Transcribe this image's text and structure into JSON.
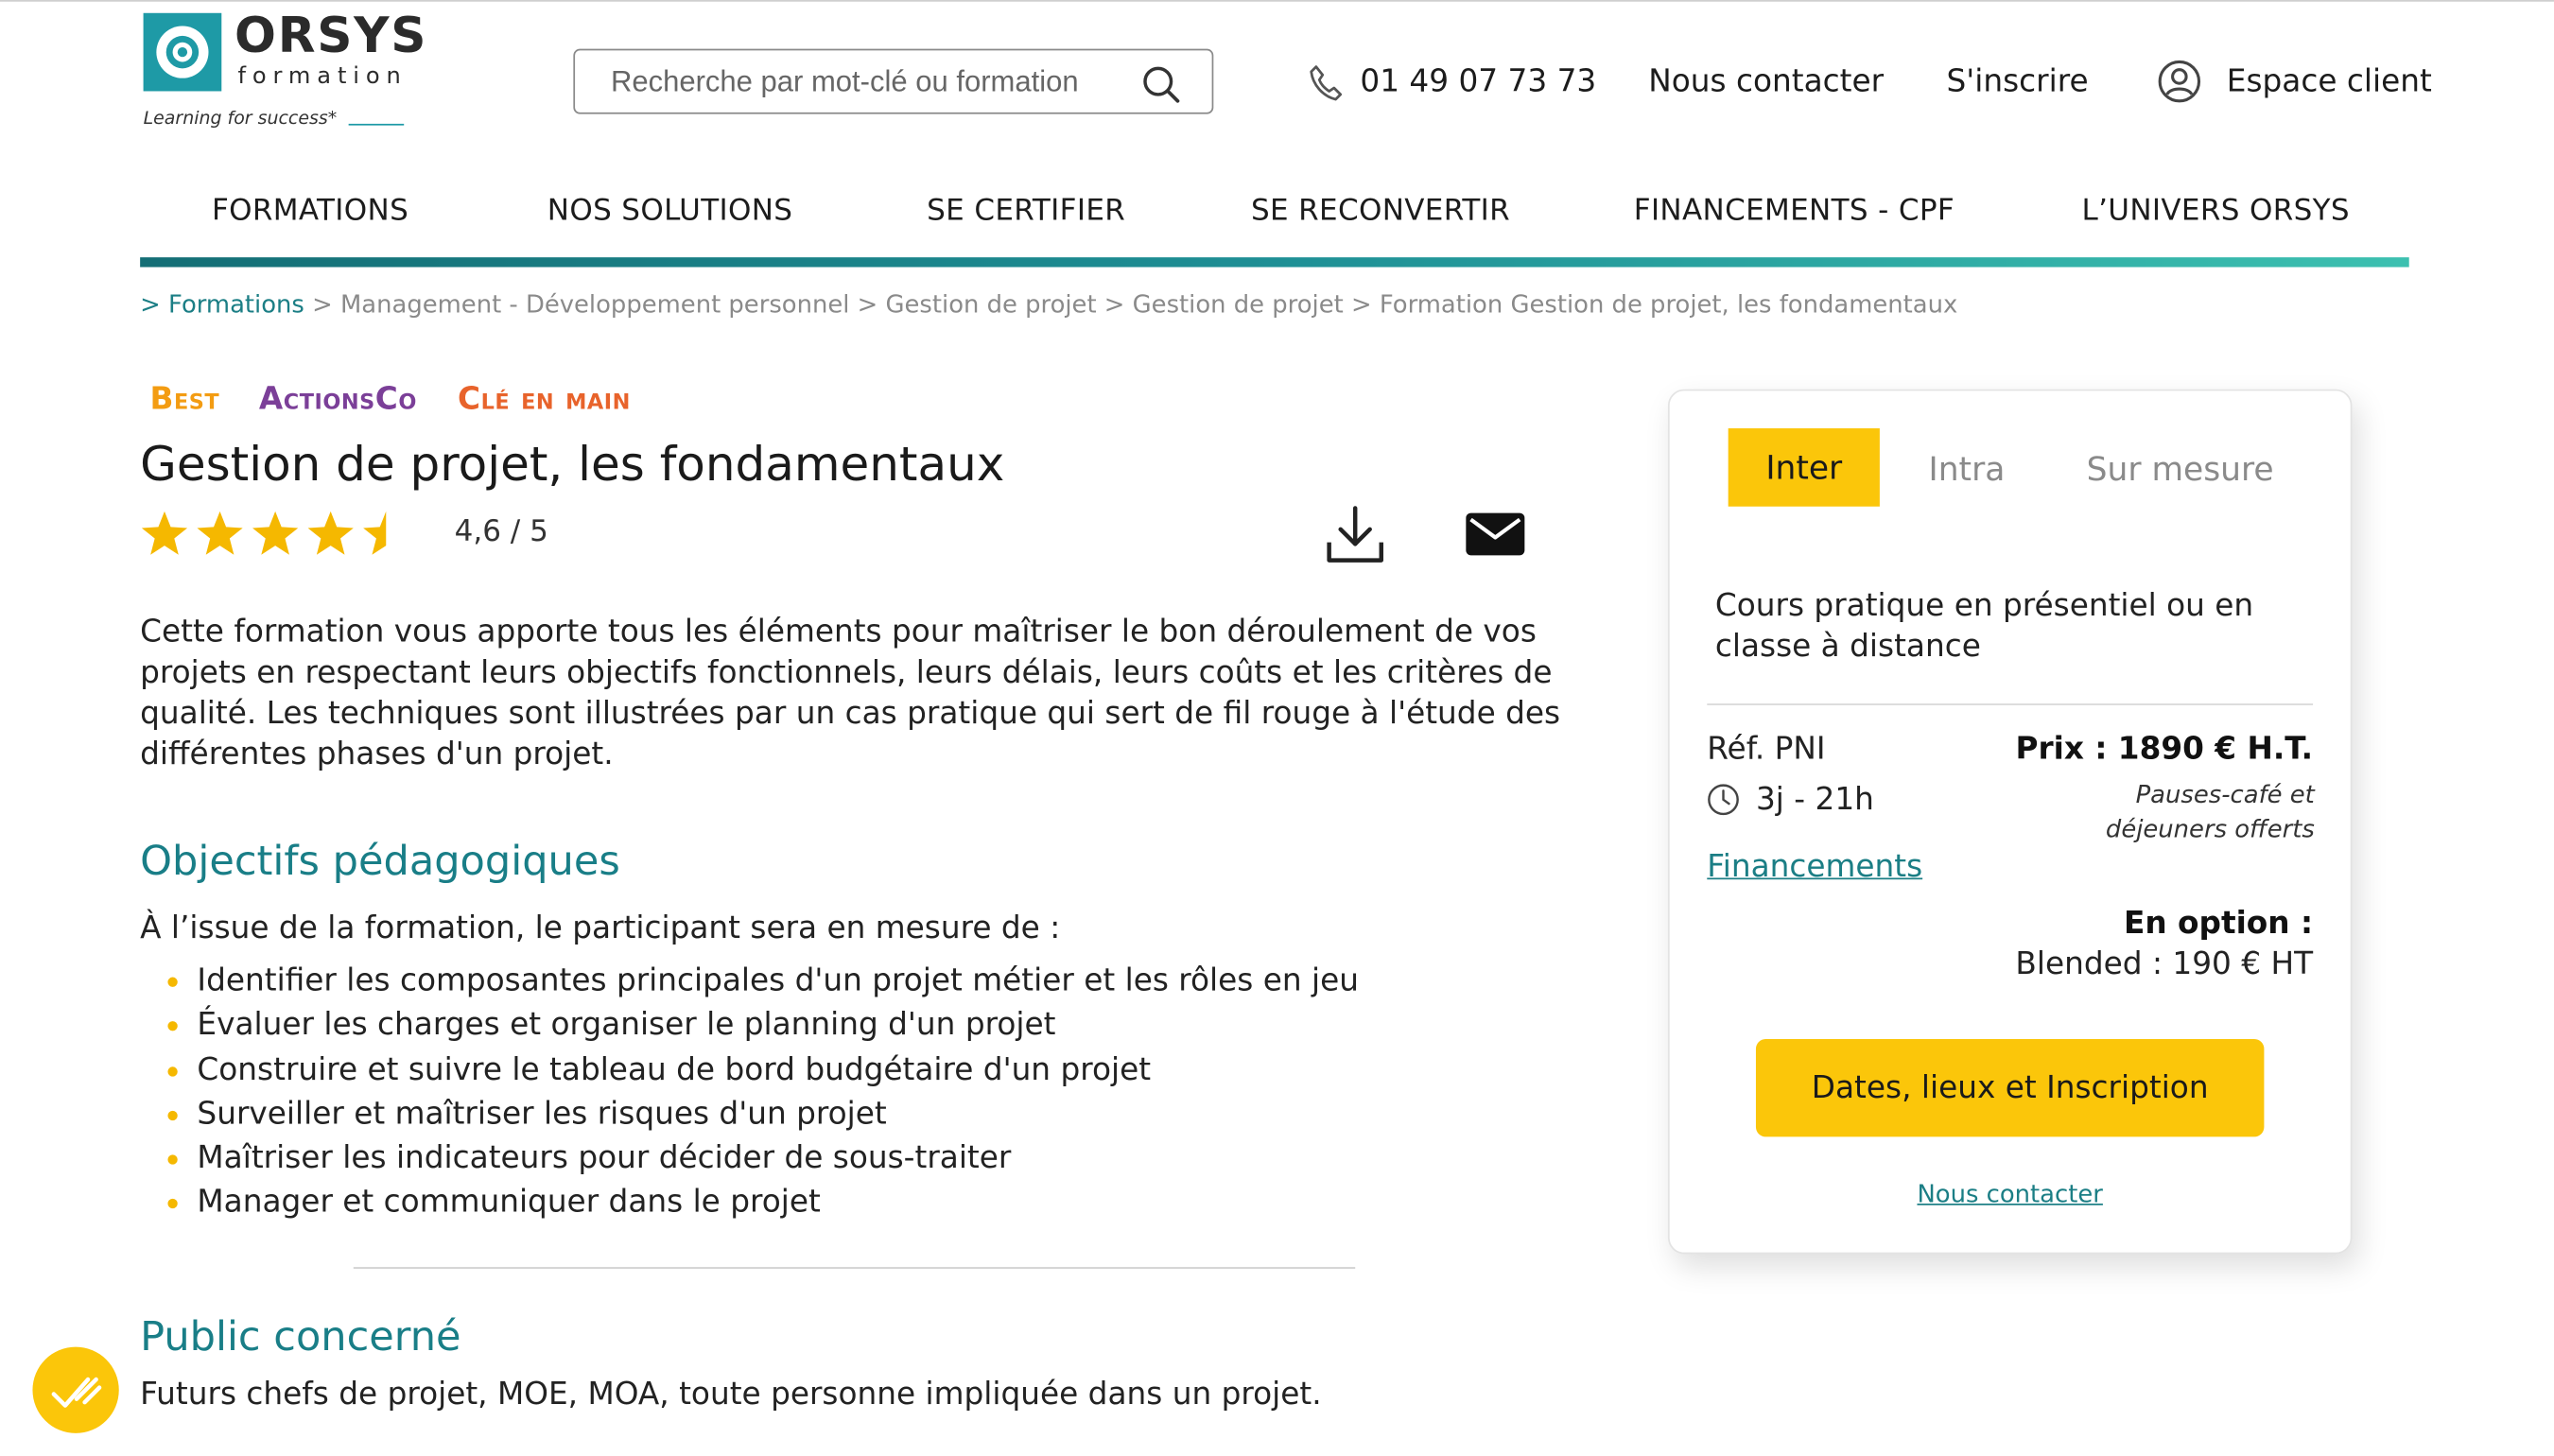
{
  "logo": {
    "name": "ORSYS",
    "sub": "formation",
    "tagline": "Learning for success*"
  },
  "search": {
    "placeholder": "Recherche par mot-clé ou formation"
  },
  "header": {
    "phone": "01 49 07 73 73",
    "contact": "Nous contacter",
    "register": "S'inscrire",
    "client": "Espace client"
  },
  "nav": [
    "FORMATIONS",
    "NOS SOLUTIONS",
    "SE CERTIFIER",
    "SE RECONVERTIR",
    "FINANCEMENTS - CPF",
    "L’UNIVERS ORSYS"
  ],
  "breadcrumb": {
    "first": "> Formations",
    "rest": " > Management - Développement personnel > Gestion de projet > Gestion de projet > Formation Gestion de projet, les fondamentaux"
  },
  "badges": [
    {
      "label": "Best",
      "color": "#f39c12"
    },
    {
      "label": "ActionsCo",
      "color": "#7b3f98"
    },
    {
      "label": "Clé en main",
      "color": "#e8632b"
    }
  ],
  "course": {
    "title": "Gestion de projet, les fondamentaux",
    "rating": 4.6,
    "rating_text": "4,6 / 5",
    "description": "Cette formation vous apporte tous les éléments pour maîtriser le bon déroulement de vos projets en respectant leurs objectifs fonctionnels, leurs délais, leurs coûts et les critères de qualité. Les techniques sont illustrées par un cas pratique qui sert de fil rouge à l'étude des différentes phases d'un projet."
  },
  "objectives": {
    "heading": "Objectifs pédagogiques",
    "intro": "À l’issue de la formation, le participant sera en mesure de :",
    "items": [
      "Identifier les composantes principales d'un projet métier et les rôles en jeu",
      "Évaluer les charges et organiser le planning d'un projet",
      "Construire et suivre le tableau de bord budgétaire d'un projet",
      "Surveiller et maîtriser les risques d'un projet",
      "Maîtriser les indicateurs pour décider de sous-traiter",
      "Manager et communiquer dans le projet"
    ]
  },
  "public": {
    "heading": "Public concerné",
    "text": "Futurs chefs de projet, MOE, MOA, toute personne impliquée dans un projet."
  },
  "card": {
    "tabs": [
      "Inter",
      "Intra",
      "Sur mesure"
    ],
    "active_tab": "Inter",
    "description": "Cours pratique en présentiel ou en classe à distance",
    "ref": "Réf. PNI",
    "price": "Prix : 1890 € H.T.",
    "duration": "3j - 21h",
    "pauses": "Pauses-café et déjeuners offerts",
    "financing": "Financements",
    "option_label": "En option :",
    "option_value": "Blended : 190 € HT",
    "cta": "Dates, lieux et Inscription",
    "contact": "Nous contacter"
  },
  "colors": {
    "accent": "#fbc60a",
    "teal": "#197e87"
  }
}
